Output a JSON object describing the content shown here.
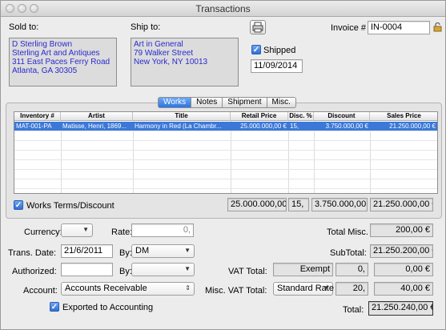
{
  "window": {
    "title": "Transactions"
  },
  "header": {
    "sold_to_label": "Sold to:",
    "ship_to_label": "Ship to:",
    "invoice_label": "Invoice #",
    "invoice_value": "IN-0004",
    "sold_to_lines": [
      "D Sterling Brown",
      "Sterling Art and Antiques",
      "311 East Paces Ferry Road",
      "Atlanta, GA 30305"
    ],
    "ship_to_lines": [
      "Art in General",
      "79 Walker Street",
      "New York, NY 10013"
    ],
    "shipped_label": "Shipped",
    "shipped_checked": true,
    "shipped_date": "11/09/2014"
  },
  "tabs": [
    {
      "label": "Works",
      "active": true
    },
    {
      "label": "Notes",
      "active": false
    },
    {
      "label": "Shipment",
      "active": false
    },
    {
      "label": "Misc.",
      "active": false
    }
  ],
  "table": {
    "columns": [
      "Inventory #",
      "Artist",
      "Title",
      "Retail Price",
      "Disc. %",
      "Discount",
      "Sales Price"
    ],
    "rows": [
      [
        "MAT-001-PA",
        "Matisse, Henri, 1869...",
        "Harmony in Red (La Chambr...",
        "25.000.000,00 €",
        "15,",
        "3.750.000,00 €",
        "21.250.000,00 €"
      ]
    ]
  },
  "totals_row": {
    "works_terms_label": "Works Terms/Discount",
    "works_terms_checked": true,
    "retail": "25.000.000,00 €",
    "disc": "15,",
    "discount": "3.750.000,00",
    "sales": "21.250.000,00 €"
  },
  "form": {
    "currency_label": "Currency:",
    "currency_value": "",
    "rate_label": "Rate:",
    "rate_value": "0,",
    "trans_date_label": "Trans. Date:",
    "trans_date_value": "21/6/2011",
    "by_label": "By:",
    "by_value": "DM",
    "authorized_label": "Authorized:",
    "authorized_value": "",
    "by2_label": "By:",
    "by2_value": "",
    "account_label": "Account:",
    "account_value": "Accounts Receivable",
    "exported_label": "Exported to Accounting",
    "exported_checked": true
  },
  "summary": {
    "total_misc_label": "Total Misc.",
    "total_misc_value": "200,00 €",
    "subtotal_label": "SubTotal:",
    "subtotal_value": "21.250.200,00 €",
    "vat_total_label": "VAT Total:",
    "vat_total_type": "Exempt",
    "vat_total_rate": "0,",
    "vat_total_value": "0,00 €",
    "misc_vat_label": "Misc. VAT Total:",
    "misc_vat_type": "Standard Rate",
    "misc_vat_rate": "20,",
    "misc_vat_value": "40,00 €",
    "total_label": "Total:",
    "total_value": "21.250.240,00 €"
  },
  "icons": {
    "print": "print-icon",
    "lock": "lock-icon",
    "chevron": "chevron-down-icon",
    "stepper": "up-down-chevron-icon"
  }
}
